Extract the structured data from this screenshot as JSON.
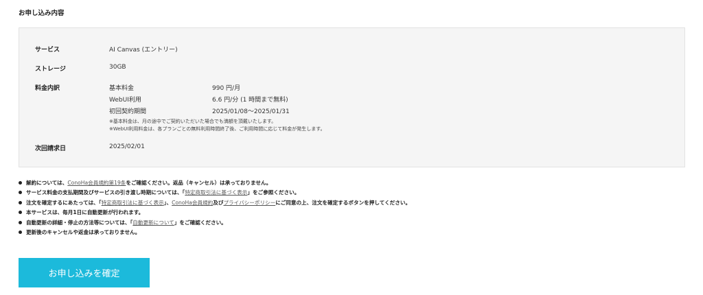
{
  "section_title": "お申し込み内容",
  "service": {
    "label": "サービス",
    "value": "AI Canvas (エントリー)"
  },
  "storage": {
    "label": "ストレージ",
    "value": "30GB"
  },
  "fees": {
    "label": "料金内訳",
    "items": [
      {
        "name": "基本料金",
        "amount": "990 円/月"
      },
      {
        "name": "WebUI利用",
        "amount": "6.6 円/分 (1 時間まで無料)"
      },
      {
        "name": "初回契約期間",
        "amount": "2025/01/08〜2025/01/31"
      }
    ],
    "notes": [
      "※基本料金は、月の途中でご契約いただいた場合でも満額を頂戴いたします。",
      "※WebUI利用料金は、各プランごとの無料利用時間終了後、ご利用時間に応じて料金が発生します。"
    ]
  },
  "next_billing": {
    "label": "次回請求日",
    "value": "2025/02/01"
  },
  "bullets": {
    "b1": {
      "pre": "解約については、",
      "link": "ConoHa会員規約第19条",
      "post": "をご確認ください。返品（キャンセル）は承っておりません。"
    },
    "b2": {
      "pre": "サービス料金の支払期間及びサービスの引き渡し時期については、「",
      "link": "特定商取引法に基づく表示",
      "post": "」をご参照ください。"
    },
    "b3": {
      "pre": "注文を確定するにあたっては、「",
      "link1": "特定商取引法に基づく表示",
      "mid1": "」、",
      "link2": "ConoHa会員規約",
      "mid2": "及び",
      "link3": "プライバシーポリシー",
      "post": "にご同意の上、注文を確定するボタンを押してください。"
    },
    "b4": {
      "text": "本サービスは、毎月1日に自動更新が行われます。"
    },
    "b5": {
      "pre": "自動更新の詳細・停止の方法等については、「",
      "link": "自動更新について",
      "post": "」をご確認ください。"
    },
    "b6": {
      "text": "更新後のキャンセルや返金は承っておりません。"
    }
  },
  "confirm_button": "お申し込みを確定"
}
